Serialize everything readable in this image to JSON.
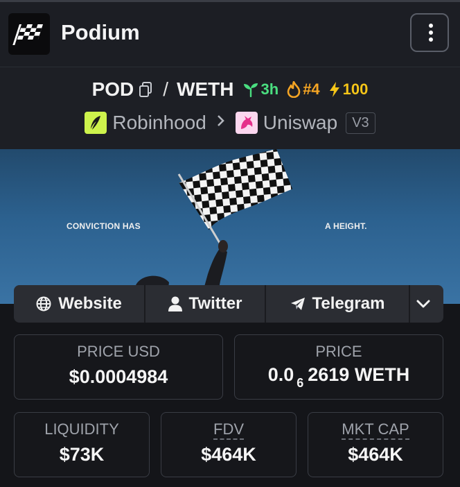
{
  "app": {
    "title": "Podium"
  },
  "pair": {
    "base": "POD",
    "separator": "/",
    "quote": "WETH",
    "age": "3h",
    "rank": "#4",
    "boost": "100"
  },
  "dex": {
    "chain": "Robinhood",
    "exchange": "Uniswap",
    "version": "V3"
  },
  "banner": {
    "text_left": "CONVICTION HAS",
    "text_right": "A HEIGHT."
  },
  "links": {
    "website": "Website",
    "twitter": "Twitter",
    "telegram": "Telegram"
  },
  "stats": {
    "price_usd": {
      "label": "PRICE USD",
      "value": "$0.0004984"
    },
    "price": {
      "label": "PRICE",
      "value_prefix": "0.0",
      "value_sub": "6",
      "value_suffix": "2619 WETH"
    },
    "liquidity": {
      "label": "LIQUIDITY",
      "value": "$73K"
    },
    "fdv": {
      "label": "FDV",
      "value": "$464K"
    },
    "mkt_cap": {
      "label": "MKT CAP",
      "value": "$464K"
    }
  },
  "colors": {
    "age": "#4ade80",
    "rank": "#f5a524",
    "boost": "#f5c518",
    "chain_bg": "#cdf34c",
    "exchange_bg": "#fcd7ef",
    "exchange_icon": "#e5318b"
  },
  "icons": {
    "logo": "checkered-flag-logo",
    "menu": "kebab-menu-icon",
    "copy": "copy-icon",
    "age": "seedling-icon",
    "rank": "flame-icon",
    "boost": "lightning-icon",
    "chain": "robinhood-feather-icon",
    "separator": "chevron-right-icon",
    "exchange": "unicorn-icon",
    "website": "globe-icon",
    "twitter": "user-icon",
    "telegram": "paper-plane-icon",
    "more": "chevron-down-icon"
  }
}
